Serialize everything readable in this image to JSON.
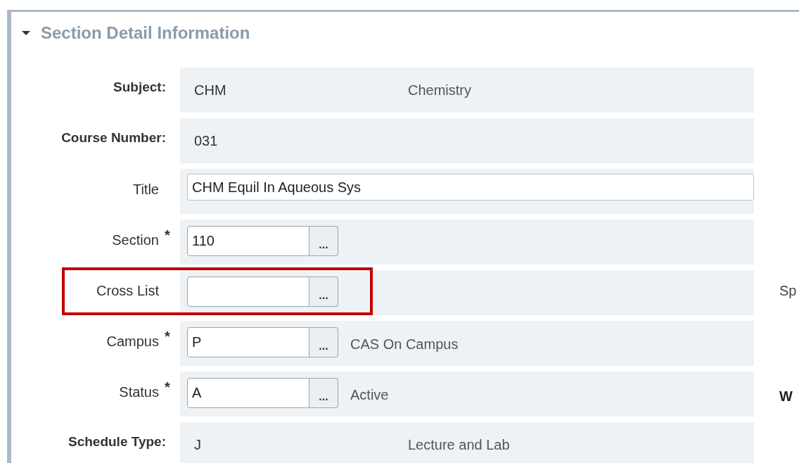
{
  "section": {
    "title": "Section Detail Information",
    "expanded": true
  },
  "rows": [
    {
      "kind": "readonly",
      "label": "Subject:",
      "code": "CHM",
      "description": "Chemistry"
    },
    {
      "kind": "readonly",
      "label": "Course Number:",
      "code": "031"
    },
    {
      "kind": "text",
      "label": "Title",
      "value": "CHM Equil In Aqueous Sys",
      "required": false
    },
    {
      "kind": "lookup",
      "label": "Section",
      "value": "110",
      "required": true
    },
    {
      "kind": "lookup",
      "label": "Cross List",
      "required": false,
      "highlighted": true,
      "side": {
        "text": "Sp",
        "bold": false
      }
    },
    {
      "kind": "lookup",
      "label": "Campus",
      "value": "P",
      "description": "CAS On Campus",
      "required": true
    },
    {
      "kind": "lookup",
      "label": "Status",
      "value": "A",
      "description": "Active",
      "required": true,
      "side": {
        "text": "W",
        "bold": true
      }
    },
    {
      "kind": "readonly",
      "label": "Schedule Type:",
      "code": "J",
      "description": "Lecture and Lab"
    }
  ],
  "lookup_button": "...",
  "required_mark": "*"
}
